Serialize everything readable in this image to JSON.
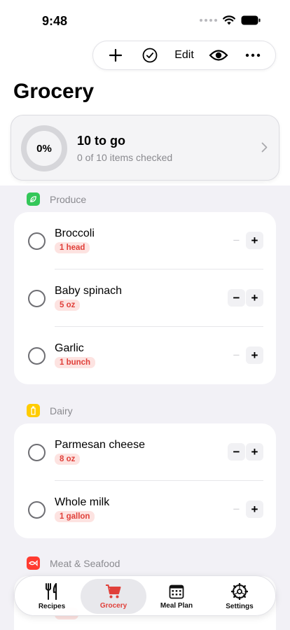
{
  "status": {
    "time": "9:48"
  },
  "toolbar": {
    "edit_label": "Edit"
  },
  "page": {
    "title": "Grocery"
  },
  "summary": {
    "percent_text": "0%",
    "progress": 0,
    "title": "10 to go",
    "subtitle": "0 of 10 items checked"
  },
  "sections": [
    {
      "name": "Produce",
      "color": "#34c759",
      "items": [
        {
          "name": "Broccoli",
          "qty": "1 head"
        },
        {
          "name": "Baby spinach",
          "qty": "5 oz"
        },
        {
          "name": "Garlic",
          "qty": "1 bunch"
        }
      ]
    },
    {
      "name": "Dairy",
      "color": "#ffcc00",
      "items": [
        {
          "name": "Parmesan cheese",
          "qty": "8 oz"
        },
        {
          "name": "Whole milk",
          "qty": "1 gallon"
        }
      ]
    },
    {
      "name": "Meat & Seafood",
      "color": "#ff3b30",
      "items": []
    }
  ],
  "tabs": [
    {
      "label": "Recipes",
      "icon": "fork-knife-icon"
    },
    {
      "label": "Grocery",
      "icon": "cart-icon"
    },
    {
      "label": "Meal Plan",
      "icon": "calendar-icon"
    },
    {
      "label": "Settings",
      "icon": "gear-icon"
    }
  ],
  "colors": {
    "accent": "#e0403a",
    "background": "#f2f1f6"
  }
}
